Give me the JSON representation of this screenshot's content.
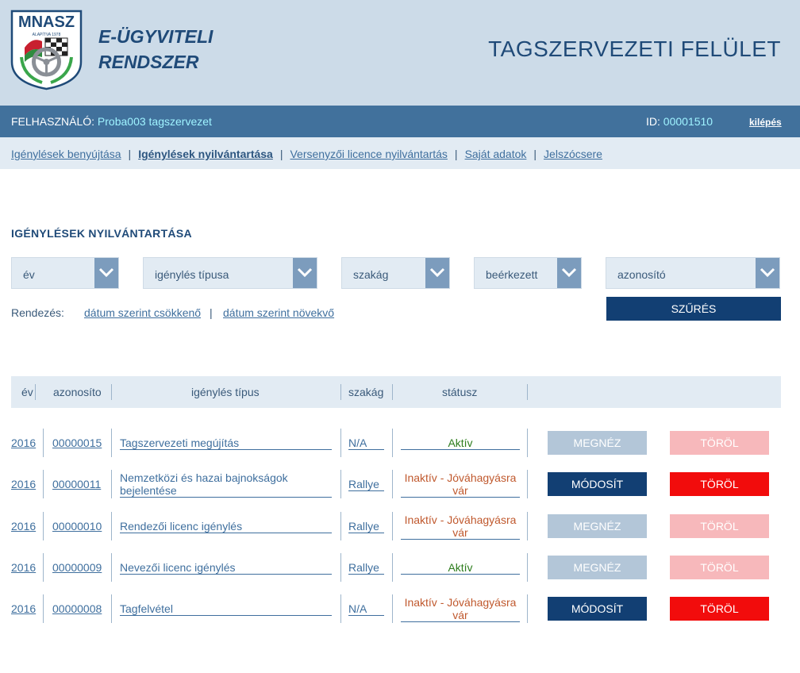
{
  "header": {
    "logo_text": "MNASZ",
    "logo_subtext": "ALAPÍTVA 1978",
    "app_title_line1": "E-ÜGYVITELI",
    "app_title_line2": "RENDSZER",
    "surface_title": "TAGSZERVEZETI FELÜLET"
  },
  "userbar": {
    "user_label": "FELHASZNÁLÓ:",
    "user_name": "Proba003 tagszervezet",
    "id_label": "ID:",
    "id_value": "00001510",
    "logout": "kilépés"
  },
  "nav": {
    "items": [
      {
        "label": "Igénylések benyújtása",
        "active": false
      },
      {
        "label": "Igénylések nyilvántartása",
        "active": true
      },
      {
        "label": "Versenyzői licence nyilvántartás",
        "active": false
      },
      {
        "label": "Saját adatok",
        "active": false
      },
      {
        "label": "Jelszócsere",
        "active": false
      }
    ],
    "separator": "|"
  },
  "main": {
    "section_title": "IGÉNYLÉSEK NYILVÁNTARTÁSA",
    "filters": {
      "year": "év",
      "request_type": "igénylés típusa",
      "branch": "szakág",
      "received": "beérkezett",
      "identifier": "azonosító"
    },
    "filter_button": "SZŰRÉS",
    "sort_label": "Rendezés:",
    "sort_desc": "dátum szerint csökkenő",
    "sort_asc": "dátum szerint növekvő",
    "sort_sep": "|"
  },
  "table": {
    "headers": {
      "year": "év",
      "id": "azonosíto",
      "type": "igénylés típus",
      "branch": "szakág",
      "status": "státusz"
    },
    "rows": [
      {
        "year": "2016",
        "id": "00000015",
        "type_line1": "Tagszervezeti megújítás",
        "type_line2": "",
        "branch": "N/A",
        "status_line1": "Aktív",
        "status_line2": "",
        "status_kind": "active",
        "action": "MEGNÉZ",
        "action_kind": "view",
        "delete": "TÖRÖL",
        "delete_kind": "del-light"
      },
      {
        "year": "2016",
        "id": "00000011",
        "type_line1": "Nemzetközi és hazai bajnokságok",
        "type_line2": "bejelentése",
        "branch": "Rallye",
        "status_line1": "Inaktív - Jóváhagyásra",
        "status_line2": "vár",
        "status_kind": "inactive",
        "action": "MÓDOSÍT",
        "action_kind": "edit",
        "delete": "TÖRÖL",
        "delete_kind": "del"
      },
      {
        "year": "2016",
        "id": "00000010",
        "type_line1": "Rendezői licenc igénylés",
        "type_line2": "",
        "branch": "Rallye",
        "status_line1": "Inaktív - Jóváhagyásra",
        "status_line2": "vár",
        "status_kind": "inactive",
        "action": "MEGNÉZ",
        "action_kind": "view",
        "delete": "TÖRÖL",
        "delete_kind": "del-light"
      },
      {
        "year": "2016",
        "id": "00000009",
        "type_line1": "Nevezői licenc igénylés",
        "type_line2": "",
        "branch": "Rallye",
        "status_line1": "Aktív",
        "status_line2": "",
        "status_kind": "active",
        "action": "MEGNÉZ",
        "action_kind": "view",
        "delete": "TÖRÖL",
        "delete_kind": "del-light"
      },
      {
        "year": "2016",
        "id": "00000008",
        "type_line1": "Tagfelvétel",
        "type_line2": "",
        "branch": "N/A",
        "status_line1": "Inaktív - Jóváhagyásra",
        "status_line2": "vár",
        "status_kind": "inactive",
        "action": "MÓDOSÍT",
        "action_kind": "edit",
        "delete": "TÖRÖL",
        "delete_kind": "del"
      }
    ]
  },
  "colors": {
    "header_bg": "#ccdbe8",
    "userbar_bg": "#41719c",
    "navbar_bg": "#e2ebf3",
    "primary_button": "#123f73",
    "delete_button": "#f20c0c",
    "active_status": "#2e7d1e",
    "inactive_status": "#c0592e"
  }
}
